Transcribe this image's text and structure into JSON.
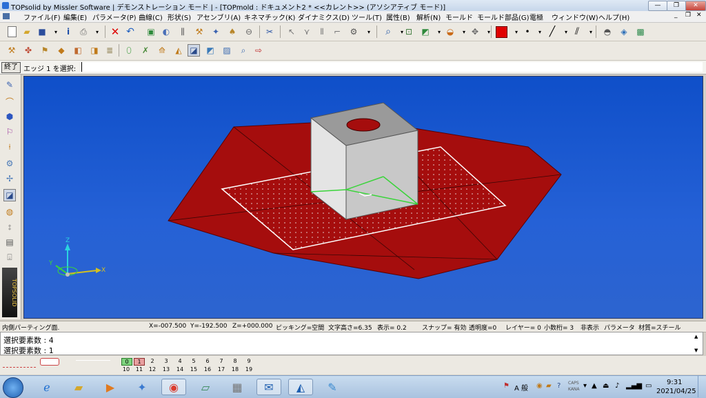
{
  "window": {
    "title": "TOPsolid by Missler Software | デモンストレーション モード | - [TOPmold : ドキュメント2 *   <<カレント>> (アソシアティブ モード)]"
  },
  "menu": {
    "items": [
      "ファイル(F)",
      "編集(E)",
      "パラメータ(P)",
      "曲線(C)",
      "形状(S)",
      "アセンブリ(A)",
      "キネマチック(K)",
      "ダイナミクス(D)",
      "ツール(T)",
      "属性(B)",
      "解析(N)",
      "モールド",
      "モールド部品(G)",
      "電極",
      "ウィンドウ(W)",
      "ヘルプ(H)"
    ]
  },
  "command": {
    "end_button": "終了",
    "prompt": "エッジ 1 を選択:",
    "input_value": ""
  },
  "viewport": {
    "axes": {
      "z": "Z",
      "y": "Y",
      "x": "X"
    }
  },
  "status": {
    "label": "内側パーティング面.",
    "x": "X=-007.500",
    "y": "Y=-192.500",
    "z": "Z=+000.000",
    "picking": "ピッキング=空間",
    "text_height": "文字高さ=6.35",
    "display": "表示=   0.2",
    "snap": "スナップ= 有効",
    "transparency": "透明度=0",
    "layer": "レイヤー=  0",
    "decimals": "小数桁= 3",
    "hidden": "非表示",
    "parameter": "パラメータ",
    "material": "材質=スチール"
  },
  "messages": [
    "選択要素数 : 4",
    "選択要素数 : 1"
  ],
  "layers": {
    "top": [
      "0",
      "1",
      "2",
      "3",
      "4",
      "5",
      "6",
      "7",
      "8",
      "9"
    ],
    "bottom": [
      "10",
      "11",
      "12",
      "13",
      "14",
      "15",
      "16",
      "17",
      "18",
      "19"
    ]
  },
  "tray": {
    "ime": "A 般",
    "caps": "CAPS",
    "kana": "KANA",
    "time": "9:31",
    "date": "2021/04/25"
  },
  "colors": {
    "viewport": "#1f5fd8",
    "parting_face": "#a50d0d",
    "block": "#c8c8c8",
    "current_color": "#e00000"
  }
}
